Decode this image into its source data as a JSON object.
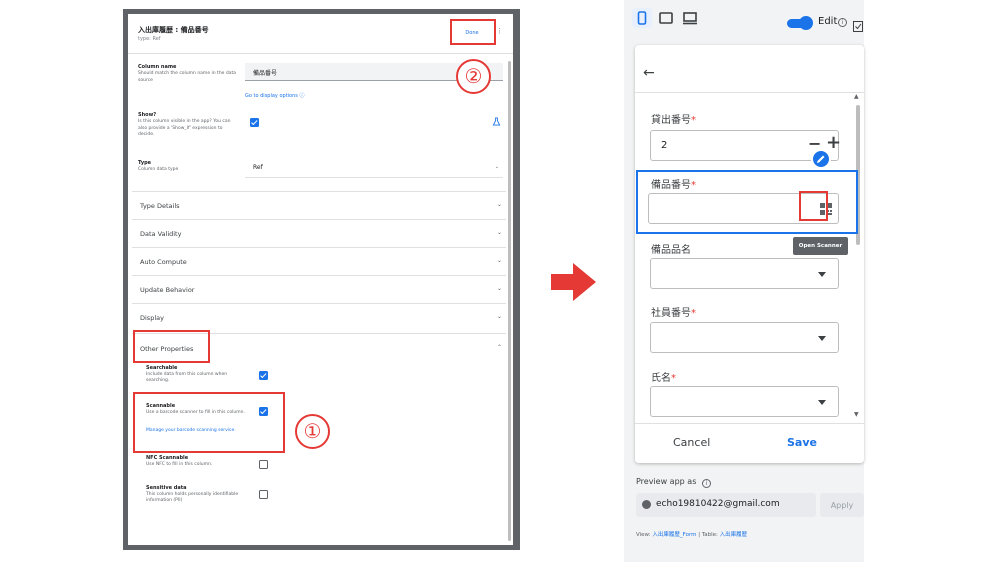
{
  "dialog": {
    "title": "入出庫履歴 : 備品番号",
    "type_line": "type: Ref",
    "done_label": "Done",
    "kebab": "⋮",
    "column_name": {
      "label": "Column name",
      "help": "Should match the column name in the data source",
      "value": "備品番号",
      "link": "Go to display options ⓘ"
    },
    "show": {
      "label": "Show?",
      "help": "Is this column visible in the app? You can also provide a 'Show_If' expression to decide.",
      "checked": true
    },
    "type": {
      "label": "Type",
      "help": "Column data type",
      "value": "Ref"
    },
    "sections": [
      {
        "label": "Type Details",
        "chevron": "⌄"
      },
      {
        "label": "Data Validity",
        "chevron": "⌄"
      },
      {
        "label": "Auto Compute",
        "chevron": "⌄"
      },
      {
        "label": "Update Behavior",
        "chevron": "⌄"
      },
      {
        "label": "Display",
        "chevron": "⌄"
      },
      {
        "label": "Other Properties",
        "chevron": "⌃"
      }
    ],
    "other_properties": [
      {
        "label": "Searchable",
        "help": "Include data from this column when searching.",
        "checked": true
      },
      {
        "label": "Scannable",
        "help": "Use a barcode scanner to fill in this column.",
        "link": "Manage your barcode scanning service.",
        "checked": true
      },
      {
        "label": "NFC Scannable",
        "help": "Use NFC to fill in this column.",
        "checked": false
      },
      {
        "label": "Sensitive data",
        "help": "This column holds personally identifiable information (PII)",
        "checked": false
      }
    ]
  },
  "annotations": {
    "step1": "①",
    "step2": "②",
    "color": "#e53935"
  },
  "preview": {
    "edit_label": "Edit",
    "devices": [
      "mobile-icon",
      "tablet-icon",
      "desktop-icon"
    ],
    "form": {
      "back": "←",
      "fields": [
        {
          "label": "貸出番号",
          "required": "*",
          "value": "2",
          "kind": "stepper"
        },
        {
          "label": "備品番号",
          "required": "*",
          "value": "",
          "kind": "scanner"
        },
        {
          "label": "備品品名",
          "required": "",
          "value": "",
          "kind": "dropdown"
        },
        {
          "label": "社員番号",
          "required": "*",
          "value": "",
          "kind": "dropdown"
        },
        {
          "label": "氏名",
          "required": "*",
          "value": "",
          "kind": "dropdown"
        }
      ],
      "stepper_minus": "−",
      "stepper_plus": "+",
      "tooltip": "Open Scanner",
      "cancel_label": "Cancel",
      "save_label": "Save"
    },
    "preview_as_label": "Preview app as",
    "preview_email": "echo19810422@gmail.com",
    "apply_label": "Apply",
    "view_prefix": "View:",
    "view_name": "入出庫履歴_Form",
    "table_prefix": "Table:",
    "table_name": "入出庫履歴",
    "separator": "|",
    "accent": "#1a73e8"
  }
}
